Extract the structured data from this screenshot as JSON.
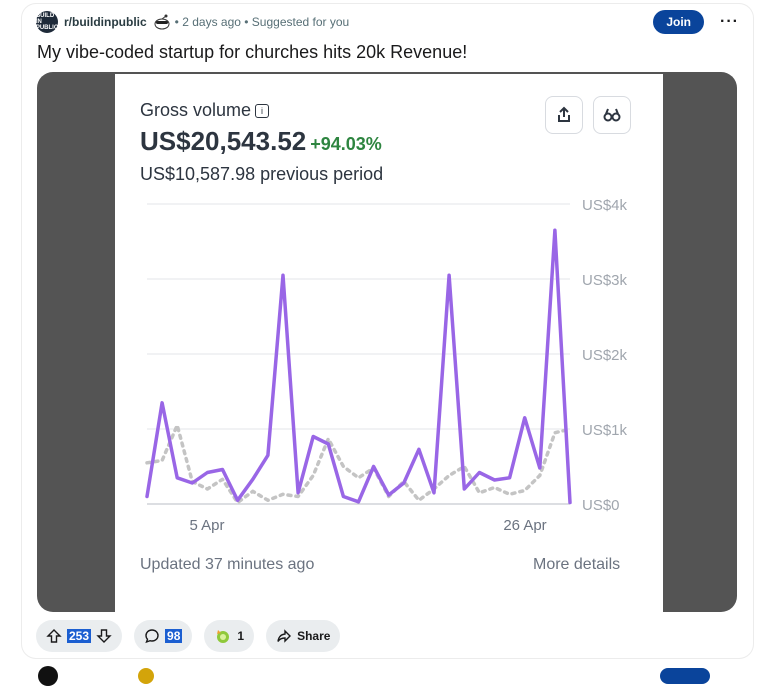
{
  "post": {
    "subreddit": "r/buildinpublic",
    "subreddit_icon_text": "BUILD IN PUBLIC",
    "meta": "• 2 days ago • Suggested for you",
    "join_label": "Join",
    "more_label": "···",
    "title": "My vibe-coded startup for churches hits 20k Revenue!"
  },
  "widget": {
    "label": "Gross volume",
    "info_icon": "i",
    "amount": "US$20,543.52",
    "change": "+94.03%",
    "previous": "US$10,587.98 previous period",
    "updated": "Updated 37 minutes ago",
    "more_details": "More details",
    "colors": {
      "current": "#9966e6",
      "previous": "#c4c4c4",
      "positive": "#2e8540"
    }
  },
  "chart_data": {
    "type": "line",
    "y_ticks": [
      "US$4k",
      "US$3k",
      "US$2k",
      "US$1k",
      "US$0"
    ],
    "x_ticks": [
      "5 Apr",
      "26 Apr"
    ],
    "ylim": [
      0,
      4000
    ],
    "grid": true,
    "series": [
      {
        "values": [
          100,
          1350,
          350,
          280,
          420,
          460,
          50,
          330,
          650,
          3050,
          150,
          900,
          800,
          100,
          30,
          500,
          120,
          280,
          730,
          150,
          3050,
          200,
          420,
          320,
          350,
          1150,
          480,
          3650,
          20
        ]
      },
      {
        "values": [
          550,
          580,
          1050,
          300,
          200,
          330,
          20,
          170,
          50,
          130,
          100,
          380,
          870,
          500,
          350,
          480,
          100,
          300,
          50,
          200,
          380,
          500,
          150,
          220,
          130,
          180,
          380,
          950,
          1000
        ]
      }
    ]
  },
  "actions": {
    "upvotes": "253",
    "comments": "98",
    "award_count": "1",
    "share_label": "Share"
  }
}
